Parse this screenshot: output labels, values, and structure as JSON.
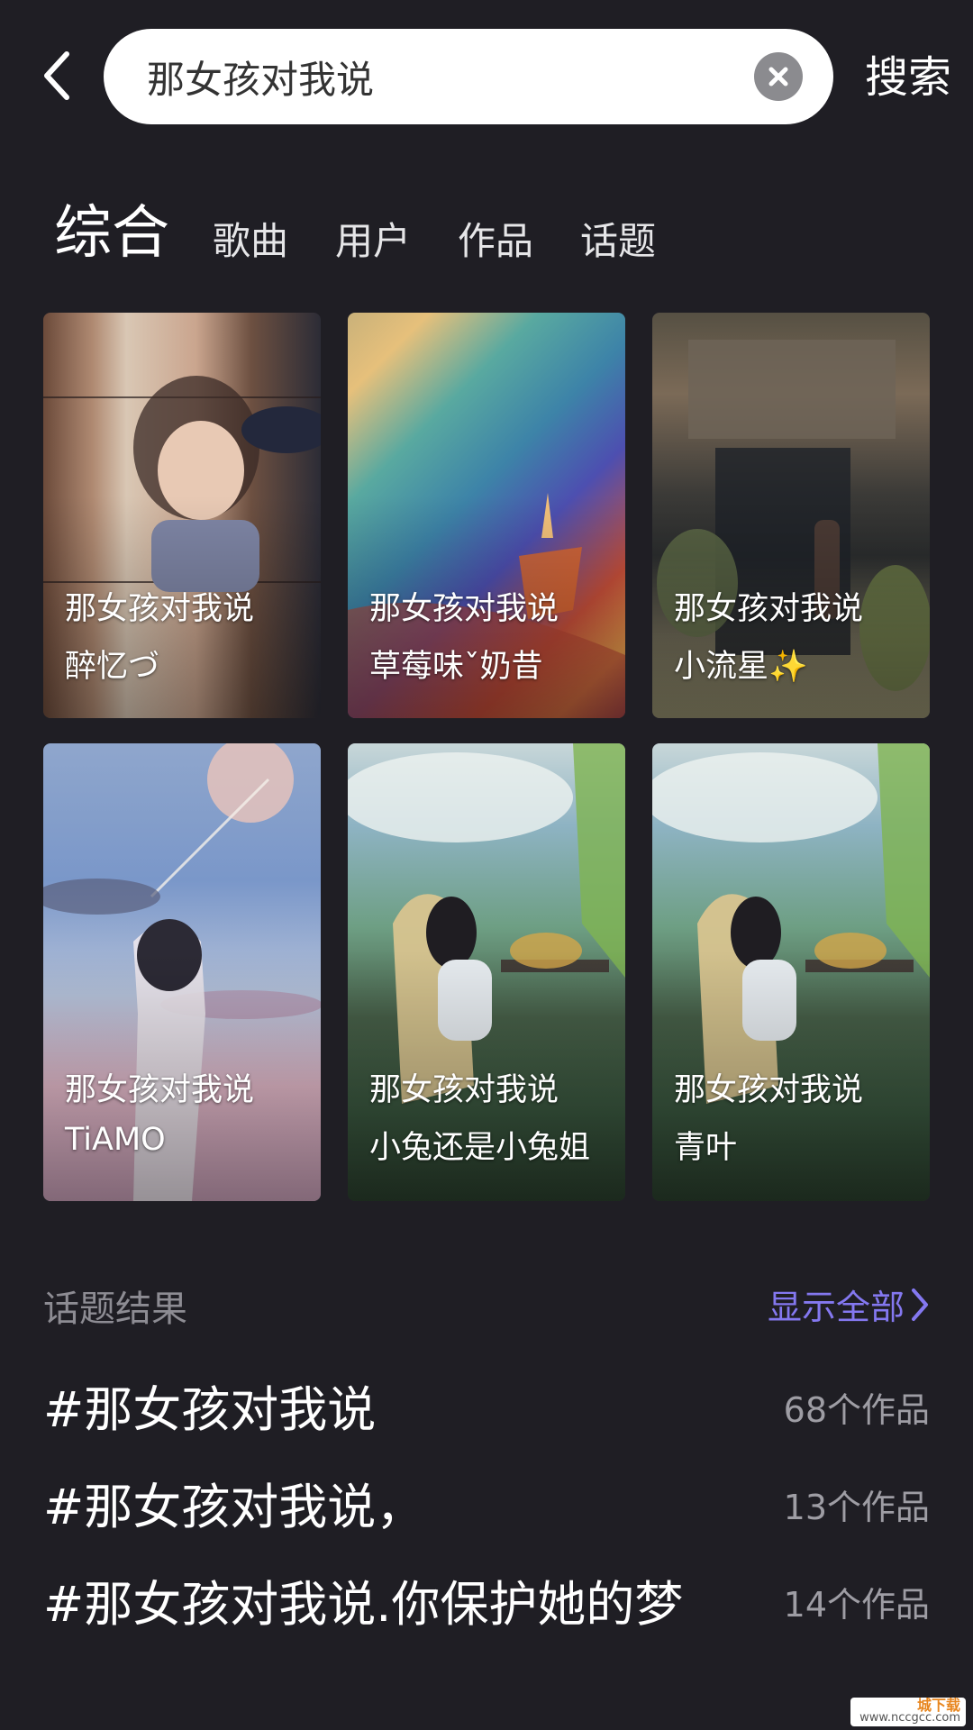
{
  "search": {
    "value": "那女孩对我说",
    "submit_label": "搜索"
  },
  "tabs": [
    {
      "label": "综合",
      "active": true
    },
    {
      "label": "歌曲",
      "active": false
    },
    {
      "label": "用户",
      "active": false
    },
    {
      "label": "作品",
      "active": false
    },
    {
      "label": "话题",
      "active": false
    }
  ],
  "works": [
    {
      "title": "那女孩对我说",
      "author": "醉忆づ"
    },
    {
      "title": "那女孩对我说",
      "author": "草莓味ˇ奶昔"
    },
    {
      "title": "那女孩对我说",
      "author": "小流星✨"
    },
    {
      "title": "那女孩对我说",
      "author": "TiAMO"
    },
    {
      "title": "那女孩对我说",
      "author": "小兔还是小兔姐"
    },
    {
      "title": "那女孩对我说",
      "author": "青叶"
    }
  ],
  "topics": {
    "section_title": "话题结果",
    "show_all_label": "显示全部",
    "items": [
      {
        "name": "#那女孩对我说",
        "count": "68个作品"
      },
      {
        "name": "#那女孩对我说，",
        "count": "13个作品"
      },
      {
        "name": "#那女孩对我说.你保护她的梦",
        "count": "14个作品"
      }
    ]
  },
  "watermark": {
    "main": "城下载",
    "sub": "www.nccgcc.com"
  },
  "colors": {
    "background": "#1f1e24",
    "accent": "#8478f0",
    "secondary_text": "#8d8c93"
  }
}
